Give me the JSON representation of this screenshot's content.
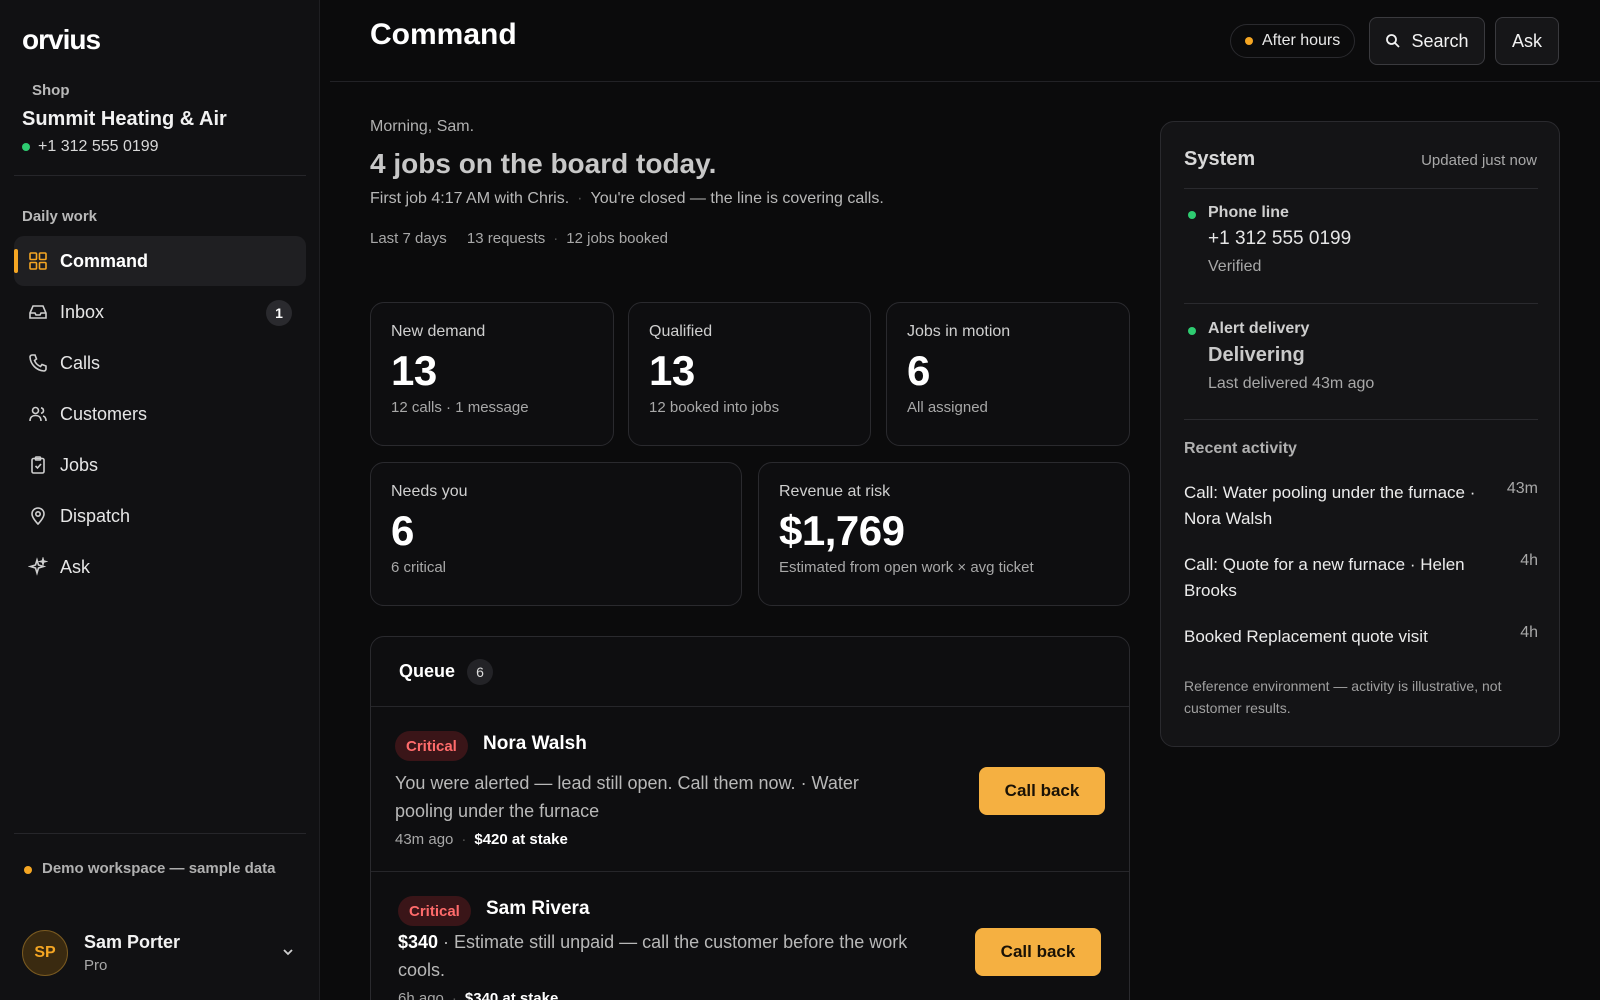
{
  "sidebar": {
    "logo": "orvius",
    "shop_label": "Shop",
    "shop_name": "Summit Heating & Air",
    "shop_phone": "+1 312 555 0199",
    "section_label": "Daily work",
    "items": [
      {
        "label": "Command",
        "icon": "grid-icon",
        "active": true
      },
      {
        "label": "Inbox",
        "icon": "inbox-icon",
        "badge": "1"
      },
      {
        "label": "Calls",
        "icon": "phone-icon"
      },
      {
        "label": "Customers",
        "icon": "users-icon"
      },
      {
        "label": "Jobs",
        "icon": "clipboard-icon"
      },
      {
        "label": "Dispatch",
        "icon": "map-pin-icon"
      },
      {
        "label": "Ask",
        "icon": "sparkle-icon"
      }
    ],
    "demo_note": "Demo workspace — sample data",
    "user": {
      "initials": "SP",
      "name": "Sam Porter",
      "plan": "Pro"
    }
  },
  "header": {
    "title": "Command",
    "status": "After hours",
    "search_label": "Search",
    "ask_label": "Ask"
  },
  "main": {
    "greeting": "Morning, Sam.",
    "headline": "4 jobs on the board today.",
    "subline_1": "First job 4:17 AM with Chris.",
    "subline_2": "You're closed — the line is covering calls.",
    "stats": [
      "Last 7 days",
      "13 requests",
      "12 jobs booked"
    ],
    "cards": {
      "new_demand": {
        "label": "New demand",
        "value": "13",
        "sub": "12 calls · 1 message"
      },
      "qualified": {
        "label": "Qualified",
        "value": "13",
        "sub": "12 booked into jobs"
      },
      "jobs_in_motion": {
        "label": "Jobs in motion",
        "value": "6",
        "sub": "All assigned"
      },
      "needs_you": {
        "label": "Needs you",
        "value": "6",
        "sub": "6 critical"
      },
      "revenue_at_risk": {
        "label": "Revenue at risk",
        "value": "$1,769",
        "sub": "Estimated from open work × avg ticket"
      }
    },
    "queue": {
      "title": "Queue",
      "count": "6",
      "items": [
        {
          "badge": "Critical",
          "name": "Nora Walsh",
          "desc": "You were alerted — lead still open. Call them now. · Water pooling under the furnace",
          "time": "43m ago",
          "stake": "$420 at stake",
          "action": "Call back"
        },
        {
          "badge": "Critical",
          "name": "Sam Rivera",
          "amount": "$340",
          "desc": " · Estimate still unpaid — call the customer before the work cools.",
          "time": "6h ago",
          "stake": "$340 at stake",
          "action": "Call back"
        }
      ]
    }
  },
  "system": {
    "title": "System",
    "updated": "Updated just now",
    "phone_line": {
      "label": "Phone line",
      "value": "+1 312 555 0199",
      "sub": "Verified"
    },
    "alert_delivery": {
      "label": "Alert delivery",
      "value": "Delivering",
      "sub": "Last delivered 43m ago"
    },
    "recent_label": "Recent activity",
    "activity": [
      {
        "text": "Call: Water pooling under the furnace · Nora Walsh",
        "time": "43m"
      },
      {
        "text": "Call: Quote for a new furnace · Helen Brooks",
        "time": "4h"
      },
      {
        "text": "Booked Replacement quote visit",
        "time": "4h"
      }
    ],
    "footnote": "Reference environment — activity is illustrative, not customer results."
  },
  "colors": {
    "accent": "#f5a623",
    "success": "#2ecc71",
    "critical": "#ff6b6b",
    "cta": "#f5b041"
  }
}
